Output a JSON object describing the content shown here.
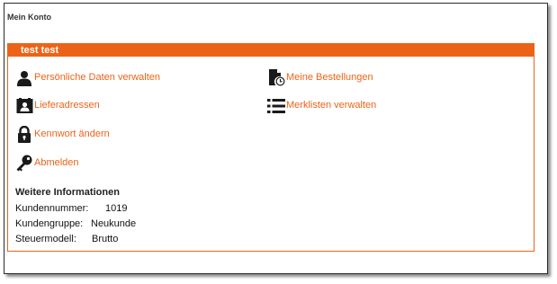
{
  "page": {
    "title": "Mein Konto"
  },
  "panel": {
    "title": "test test"
  },
  "links": {
    "personal_data": "Persönliche Daten verwalten",
    "addresses": "Lieferadressen",
    "password": "Kennwort ändern",
    "logout": "Abmelden",
    "orders": "Meine Bestellungen",
    "wishlists": "Merklisten verwalten"
  },
  "info": {
    "title": "Weitere Informationen",
    "rows": [
      {
        "label": "Kundennummer:",
        "value": "1019"
      },
      {
        "label": "Kundengruppe:",
        "value": "Neukunde"
      },
      {
        "label": "Steuermodell:",
        "value": "Brutto"
      }
    ]
  },
  "icons": {
    "personal_data": "user-icon",
    "addresses": "address-card-icon",
    "password": "lock-icon",
    "logout": "key-icon",
    "orders": "order-history-icon",
    "wishlists": "list-icon"
  },
  "colors": {
    "accent": "#ec6318",
    "text": "#222222",
    "icon": "#1a1a1a"
  }
}
